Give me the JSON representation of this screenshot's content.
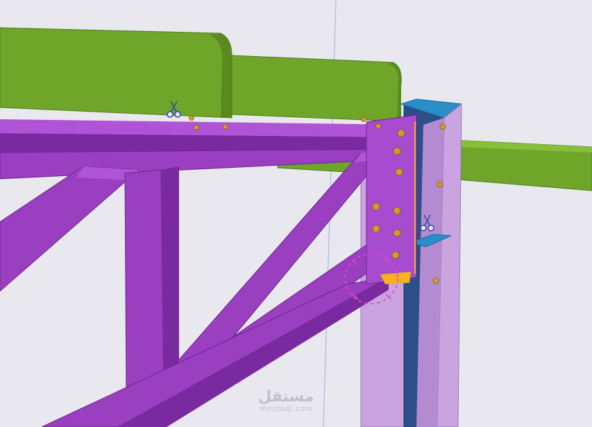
{
  "viewport": {
    "background": "#e8e8ee",
    "grid_line_color": "#9db2dc"
  },
  "colors": {
    "purple_member": "#9a3fc0",
    "purple_dark": "#7a2aa0",
    "light_purple_column": "#c9a4e0",
    "green_member": "#6fa62a",
    "green_dark": "#5a8a1e",
    "blue_column": "#2c4f8c",
    "cyan_plate": "#2a8ec9",
    "bolt": "#d79a2b",
    "cut_marker": "#3a46a8",
    "selection_circle": "#e04ac8",
    "weld_yellow": "#f5b21c"
  },
  "icons": {
    "cut_marker": "scissors-icon",
    "weld_selection": "dashed-circle-icon"
  },
  "watermark": {
    "logo_text": "مستقل",
    "url": "mostaql.com"
  }
}
